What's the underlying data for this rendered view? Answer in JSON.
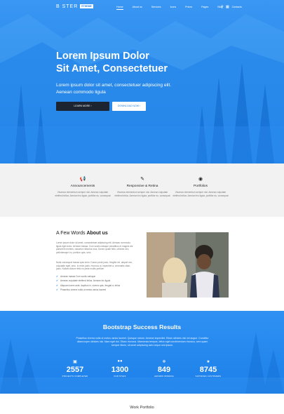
{
  "nav": {
    "logo_text": "B   STER",
    "logo_badge": "ETHEME",
    "menu": [
      "Home",
      "About us",
      "Services",
      "Icons",
      "Prices",
      "Pages",
      "Blog",
      "Contacts"
    ],
    "search_icon": "search-icon",
    "menu_icon": "grid-icon"
  },
  "hero": {
    "title_line1": "Lorem Ipsum Dolor",
    "title_line2": "Sit Amet, Consectetuer",
    "subtitle": "Lorem ipsum dolor sit amet, consectetuer adipiscing elit. Aenean commodo ligula",
    "btn_primary": "LEARN MORE  ›",
    "btn_secondary": "DOWNLOAD NOW  ›",
    "accent": "#1a7fe8"
  },
  "features": [
    {
      "icon": "megaphone-icon",
      "title": "Announcements",
      "text": "Vivamus elementum semper nisi. Aenean vulputate eleifend tellus. Aenean leo ligula, porttitor eu, consequat"
    },
    {
      "icon": "pen-icon",
      "title": "Responsive & Retina",
      "text": "Vivamus elementum semper nisi. Aenean vulputate eleifend tellus. Aenean leo ligula, porttitor eu, consequat"
    },
    {
      "icon": "camera-icon",
      "title": "Portfolios",
      "text": "Vivamus elementum semper nisi. Aenean vulputate eleifend tellus. Aenean leo ligula, porttitor eu, consequat"
    }
  ],
  "about": {
    "title_plain": "A Few Words ",
    "title_bold": "About us",
    "para1": "Lorem ipsum dolor sit amet, consectetuer adipiscing elit. Aenean commodo ligula eget dolor. Aenean massa. Cum sociis natoque penatibus et magnis dis parturient montes, nascetur ridiculus mus. Donec quam felis, ultricies nec, pellentesque eu, pretium quis, sem.",
    "para2": "Nulla consequat massa quis enim. Donec pede justo, fringilla vel, aliquet nec, vulputate eget, arcu. In enim justo, rhoncus ut, imperdiet a, venenatis vitae, justo. Nullam dictum felis eu pede mollis pretium.",
    "list": [
      "Aenean massa Cum sociis natoque",
      "Aenean vulputate eleifend tellus. Aenean leo ligula",
      "Aliquam lorem ante, dapibus in, viverra quis, feugiat a, tellus",
      "Phasellus viverra nulla ut metus varius laoreet"
    ]
  },
  "stats": {
    "title": "Bootstrap Success Results",
    "text": "Phasellus viverra nulla ut metus varius laoreet. Quisque rutrum. Aenean imperdiet. Etiam ultricies nisi vel augue. Curabitur ullamcorper ultricies nisi. Nam eget dui. Etiam rhoncus. Maecenas tempus, tellus eget condimentum rhoncus, sem quam semper libero, sit amet adipiscing sem neque sed ipsum.",
    "items": [
      {
        "icon": "briefcase-icon",
        "number": "2557",
        "label": "PROJECTS COMPLETED"
      },
      {
        "icon": "users-icon",
        "number": "1300",
        "label": "OUR STAFF"
      },
      {
        "icon": "snowflake-icon",
        "number": "849",
        "label": "AWARDS WINNING"
      },
      {
        "icon": "trophy-icon",
        "number": "8745",
        "label": "SATISFIED CUSTOMERS"
      }
    ]
  },
  "portfolio": {
    "title": "Work Portfolio"
  }
}
